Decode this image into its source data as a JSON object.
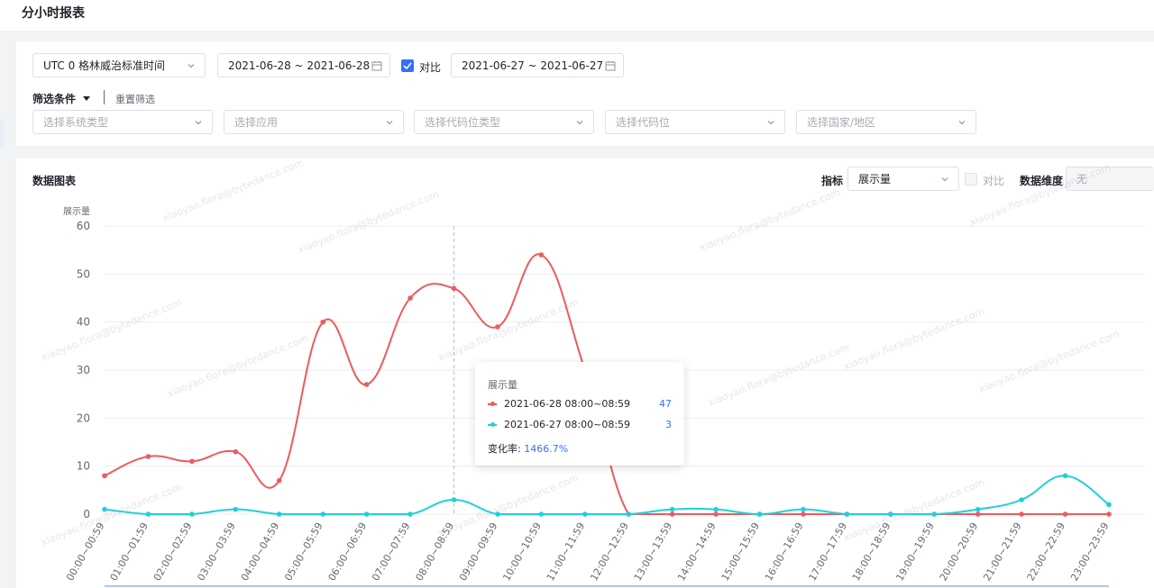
{
  "page": {
    "title": "分小时报表"
  },
  "filters": {
    "timezone": "UTC 0 格林威治标准时间",
    "date_range": "2021-06-28 ~ 2021-06-28",
    "compare_label": "对比",
    "compare_checked": true,
    "compare_range": "2021-06-27 ~ 2021-06-27",
    "conditions_label": "筛选条件",
    "reset_label": "重置筛选",
    "selects": [
      {
        "placeholder": "选择系统类型"
      },
      {
        "placeholder": "选择应用"
      },
      {
        "placeholder": "选择代码位类型"
      },
      {
        "placeholder": "选择代码位"
      },
      {
        "placeholder": "选择国家/地区"
      }
    ]
  },
  "chart_panel": {
    "title": "数据图表",
    "metric_label": "指标",
    "metric_value": "展示量",
    "compare_label": "对比",
    "compare_checked": false,
    "dimension_label": "数据维度",
    "dimension_value": "无"
  },
  "tooltip": {
    "title": "展示量",
    "rows": [
      {
        "name": "2021-06-28 08:00~08:59",
        "value": "47"
      },
      {
        "name": "2021-06-27 08:00~08:59",
        "value": "3"
      }
    ],
    "change_label": "变化率:",
    "change_value": "1466.7%"
  },
  "watermark": "xiaoyao.flora@bytedance.com",
  "colors": {
    "accent": "#3370ff",
    "series_current": "#ee5a5d",
    "series_compare": "#1fd0dc"
  },
  "chart_data": {
    "type": "line",
    "ylabel": "展示量",
    "ylim": [
      0,
      60
    ],
    "yticks": [
      0,
      10,
      20,
      30,
      40,
      50,
      60
    ],
    "categories": [
      "00:00~00:59",
      "01:00~01:59",
      "02:00~02:59",
      "03:00~03:59",
      "04:00~04:59",
      "05:00~05:59",
      "06:00~06:59",
      "07:00~07:59",
      "08:00~08:59",
      "09:00~09:59",
      "10:00~10:59",
      "11:00~11:59",
      "12:00~12:59",
      "13:00~13:59",
      "14:00~14:59",
      "15:00~15:59",
      "16:00~16:59",
      "17:00~17:59",
      "18:00~18:59",
      "19:00~19:59",
      "20:00~20:59",
      "21:00~21:59",
      "22:00~22:59",
      "23:00~23:59"
    ],
    "series": [
      {
        "name": "2021-06-28",
        "color": "#ee5a5d",
        "values": [
          8,
          12,
          11,
          13,
          7,
          40,
          27,
          45,
          47,
          39,
          54,
          30,
          0,
          0,
          0,
          0,
          0,
          0,
          0,
          0,
          0,
          0,
          0,
          0
        ]
      },
      {
        "name": "2021-06-27",
        "color": "#1fd0dc",
        "values": [
          1,
          0,
          0,
          1,
          0,
          0,
          0,
          0,
          3,
          0,
          0,
          0,
          0,
          1,
          1,
          0,
          1,
          0,
          0,
          0,
          1,
          3,
          8,
          2
        ]
      }
    ],
    "highlight_index": 8,
    "grid": true,
    "smooth": true
  }
}
